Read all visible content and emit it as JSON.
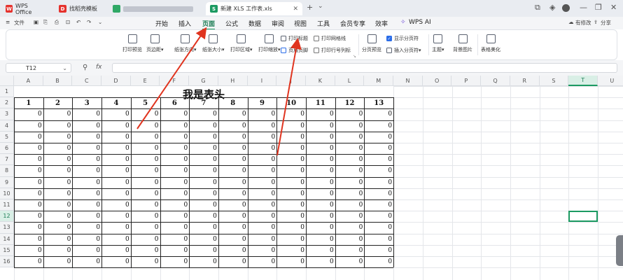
{
  "tabs": {
    "wps": {
      "label": "WPS Office",
      "icon": "wps-logo-icon"
    },
    "find": {
      "label": "找稻壳模板",
      "icon": "docer-icon"
    },
    "xls": {
      "label": "新建 XLS 工作表.xls",
      "icon": "spreadsheet-s-icon"
    },
    "new_tab": "+",
    "dropdown": "⌄"
  },
  "menubar": {
    "left_label": "文件",
    "items": [
      "开始",
      "插入",
      "页面",
      "公式",
      "数据",
      "审阅",
      "视图",
      "工具",
      "会员专享",
      "效率"
    ],
    "active": "页面",
    "wps_ai": "WPS AI",
    "modify": "有修改",
    "share": "分享"
  },
  "ribbon": {
    "print_preview": "打印预览",
    "margins": "页边距",
    "orientation": "纸张方向",
    "paper_size": "纸张大小",
    "print_area": "打印区域",
    "print_scale": "打印缩放",
    "print_titles": "打印标题",
    "header_footer": "页眉页脚",
    "print_gridlines": "打印网格线",
    "print_row_col": "打印行号列标",
    "page_break_preview": "分页预览",
    "show_page_breaks": "显示分页符",
    "insert_page_break": "插入分页符",
    "theme": "主题",
    "background": "背景图片",
    "table_beautify": "表格美化",
    "print_gridlines_checked": false,
    "print_row_col_checked": false,
    "show_page_breaks_checked": true
  },
  "formula": {
    "name_box": "T12",
    "fx": "fx",
    "zoom_icon": "search-icon"
  },
  "sheet": {
    "columns": [
      "A",
      "B",
      "C",
      "D",
      "E",
      "F",
      "G",
      "H",
      "I",
      "J",
      "K",
      "L",
      "M",
      "N",
      "O",
      "P",
      "Q",
      "R",
      "S",
      "T",
      "U"
    ],
    "rows": [
      "1",
      "2",
      "3",
      "4",
      "5",
      "6",
      "7",
      "8",
      "9",
      "10",
      "11",
      "12",
      "13",
      "14",
      "15",
      "16"
    ],
    "selected_col": "T",
    "selected_row": "12",
    "title": "我是表头",
    "header_row": [
      "1",
      "2",
      "3",
      "4",
      "5",
      "6",
      "7",
      "8",
      "9",
      "10",
      "11",
      "12",
      "13"
    ],
    "data_value": "0",
    "data_rows": 14
  },
  "colors": {
    "accent": "#1c9a62",
    "arrow": "#e0341f",
    "checkbox_on": "#2b6de8"
  }
}
